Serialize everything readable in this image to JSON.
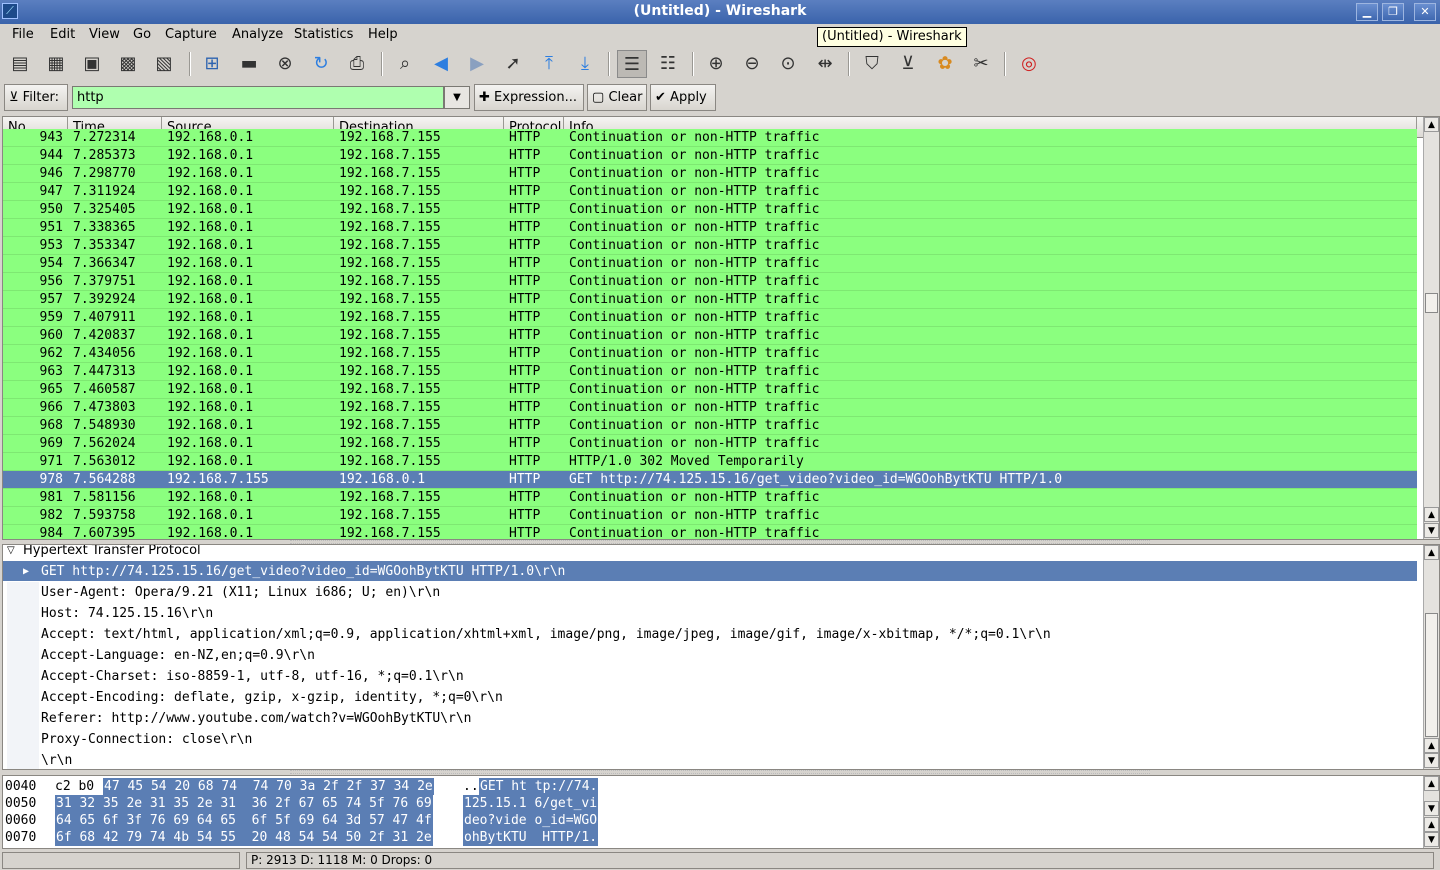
{
  "window": {
    "title": "(Untitled) - Wireshark",
    "tooltip": "(Untitled) - Wireshark",
    "accent": "#3a63ab"
  },
  "menu": [
    "File",
    "Edit",
    "View",
    "Go",
    "Capture",
    "Analyze",
    "Statistics",
    "Help"
  ],
  "toolbar_icons": [
    "interfaces-icon",
    "capture-options-icon",
    "capture-start-icon",
    "capture-stop-icon",
    "capture-restart-icon",
    "open-file-icon",
    "save-file-icon",
    "close-file-icon",
    "reload-icon",
    "print-icon",
    "find-packet-icon",
    "go-back-icon",
    "go-forward-icon",
    "go-to-packet-icon",
    "go-first-icon",
    "go-last-icon",
    "colorize-icon",
    "autoscroll-icon",
    "zoom-in-icon",
    "zoom-out-icon",
    "zoom-normal-icon",
    "resize-columns-icon",
    "capture-filters-icon",
    "display-filters-icon",
    "coloring-rules-icon",
    "preferences-icon",
    "help-icon"
  ],
  "filter": {
    "label": "Filter:",
    "value": "http",
    "expression_label": "Expression...",
    "clear_label": "Clear",
    "apply_label": "Apply",
    "color": "#afffaf"
  },
  "packet_list": {
    "columns": [
      "No. .",
      "Time",
      "Source",
      "Destination",
      "Protocol",
      "Info"
    ],
    "row_color": "#8bff7f",
    "selected_color": "#5b7eb4",
    "rows": [
      {
        "no": "943",
        "time": "7.272314",
        "src": "192.168.0.1",
        "dst": "192.168.7.155",
        "proto": "HTTP",
        "info": "Continuation or non-HTTP traffic"
      },
      {
        "no": "944",
        "time": "7.285373",
        "src": "192.168.0.1",
        "dst": "192.168.7.155",
        "proto": "HTTP",
        "info": "Continuation or non-HTTP traffic"
      },
      {
        "no": "946",
        "time": "7.298770",
        "src": "192.168.0.1",
        "dst": "192.168.7.155",
        "proto": "HTTP",
        "info": "Continuation or non-HTTP traffic"
      },
      {
        "no": "947",
        "time": "7.311924",
        "src": "192.168.0.1",
        "dst": "192.168.7.155",
        "proto": "HTTP",
        "info": "Continuation or non-HTTP traffic"
      },
      {
        "no": "950",
        "time": "7.325405",
        "src": "192.168.0.1",
        "dst": "192.168.7.155",
        "proto": "HTTP",
        "info": "Continuation or non-HTTP traffic"
      },
      {
        "no": "951",
        "time": "7.338365",
        "src": "192.168.0.1",
        "dst": "192.168.7.155",
        "proto": "HTTP",
        "info": "Continuation or non-HTTP traffic"
      },
      {
        "no": "953",
        "time": "7.353347",
        "src": "192.168.0.1",
        "dst": "192.168.7.155",
        "proto": "HTTP",
        "info": "Continuation or non-HTTP traffic"
      },
      {
        "no": "954",
        "time": "7.366347",
        "src": "192.168.0.1",
        "dst": "192.168.7.155",
        "proto": "HTTP",
        "info": "Continuation or non-HTTP traffic"
      },
      {
        "no": "956",
        "time": "7.379751",
        "src": "192.168.0.1",
        "dst": "192.168.7.155",
        "proto": "HTTP",
        "info": "Continuation or non-HTTP traffic"
      },
      {
        "no": "957",
        "time": "7.392924",
        "src": "192.168.0.1",
        "dst": "192.168.7.155",
        "proto": "HTTP",
        "info": "Continuation or non-HTTP traffic"
      },
      {
        "no": "959",
        "time": "7.407911",
        "src": "192.168.0.1",
        "dst": "192.168.7.155",
        "proto": "HTTP",
        "info": "Continuation or non-HTTP traffic"
      },
      {
        "no": "960",
        "time": "7.420837",
        "src": "192.168.0.1",
        "dst": "192.168.7.155",
        "proto": "HTTP",
        "info": "Continuation or non-HTTP traffic"
      },
      {
        "no": "962",
        "time": "7.434056",
        "src": "192.168.0.1",
        "dst": "192.168.7.155",
        "proto": "HTTP",
        "info": "Continuation or non-HTTP traffic"
      },
      {
        "no": "963",
        "time": "7.447313",
        "src": "192.168.0.1",
        "dst": "192.168.7.155",
        "proto": "HTTP",
        "info": "Continuation or non-HTTP traffic"
      },
      {
        "no": "965",
        "time": "7.460587",
        "src": "192.168.0.1",
        "dst": "192.168.7.155",
        "proto": "HTTP",
        "info": "Continuation or non-HTTP traffic"
      },
      {
        "no": "966",
        "time": "7.473803",
        "src": "192.168.0.1",
        "dst": "192.168.7.155",
        "proto": "HTTP",
        "info": "Continuation or non-HTTP traffic"
      },
      {
        "no": "968",
        "time": "7.548930",
        "src": "192.168.0.1",
        "dst": "192.168.7.155",
        "proto": "HTTP",
        "info": "Continuation or non-HTTP traffic"
      },
      {
        "no": "969",
        "time": "7.562024",
        "src": "192.168.0.1",
        "dst": "192.168.7.155",
        "proto": "HTTP",
        "info": "Continuation or non-HTTP traffic"
      },
      {
        "no": "971",
        "time": "7.563012",
        "src": "192.168.0.1",
        "dst": "192.168.7.155",
        "proto": "HTTP",
        "info": "HTTP/1.0 302 Moved Temporarily"
      },
      {
        "no": "978",
        "time": "7.564288",
        "src": "192.168.7.155",
        "dst": "192.168.0.1",
        "proto": "HTTP",
        "info": "GET http://74.125.15.16/get_video?video_id=WGOohBytKTU HTTP/1.0",
        "selected": true
      },
      {
        "no": "981",
        "time": "7.581156",
        "src": "192.168.0.1",
        "dst": "192.168.7.155",
        "proto": "HTTP",
        "info": "Continuation or non-HTTP traffic"
      },
      {
        "no": "982",
        "time": "7.593758",
        "src": "192.168.0.1",
        "dst": "192.168.7.155",
        "proto": "HTTP",
        "info": "Continuation or non-HTTP traffic"
      },
      {
        "no": "984",
        "time": "7.607395",
        "src": "192.168.0.1",
        "dst": "192.168.7.155",
        "proto": "HTTP",
        "info": "Continuation or non-HTTP traffic"
      }
    ]
  },
  "details": {
    "root": "Hypertext Transfer Protocol",
    "lines": [
      {
        "text": "GET http://74.125.15.16/get_video?video_id=WGOohBytKTU HTTP/1.0\\r\\n",
        "selected": true,
        "expandable": true
      },
      {
        "text": "User-Agent: Opera/9.21 (X11; Linux i686; U; en)\\r\\n"
      },
      {
        "text": "Host: 74.125.15.16\\r\\n"
      },
      {
        "text": "Accept: text/html, application/xml;q=0.9, application/xhtml+xml, image/png, image/jpeg, image/gif, image/x-xbitmap, */*;q=0.1\\r\\n"
      },
      {
        "text": "Accept-Language: en-NZ,en;q=0.9\\r\\n"
      },
      {
        "text": "Accept-Charset: iso-8859-1, utf-8, utf-16, *;q=0.1\\r\\n"
      },
      {
        "text": "Accept-Encoding: deflate, gzip, x-gzip, identity, *;q=0\\r\\n"
      },
      {
        "text": "Referer: http://www.youtube.com/watch?v=WGOohBytKTU\\r\\n"
      },
      {
        "text": "Proxy-Connection: close\\r\\n"
      },
      {
        "text": "\\r\\n"
      }
    ]
  },
  "hex": [
    {
      "offset": "0040",
      "pre": "c2 b0",
      "hex": "47 45 54 20 68 74  74 70 3a 2f 2f 37 34 2e",
      "ascii_pre": "..",
      "ascii": "GET ht tp://74."
    },
    {
      "offset": "0050",
      "pre": "",
      "hex": "31 32 35 2e 31 35 2e 31  36 2f 67 65 74 5f 76 69",
      "ascii_pre": "",
      "ascii": "125.15.1 6/get_vi"
    },
    {
      "offset": "0060",
      "pre": "",
      "hex": "64 65 6f 3f 76 69 64 65  6f 5f 69 64 3d 57 47 4f",
      "ascii_pre": "",
      "ascii": "deo?vide o_id=WGO"
    },
    {
      "offset": "0070",
      "pre": "",
      "hex": "6f 68 42 79 74 4b 54 55  20 48 54 54 50 2f 31 2e",
      "ascii_pre": "",
      "ascii": "ohBytKTU  HTTP/1."
    }
  ],
  "status": {
    "left": "",
    "main": "P: 2913 D: 1118 M: 0 Drops: 0"
  }
}
